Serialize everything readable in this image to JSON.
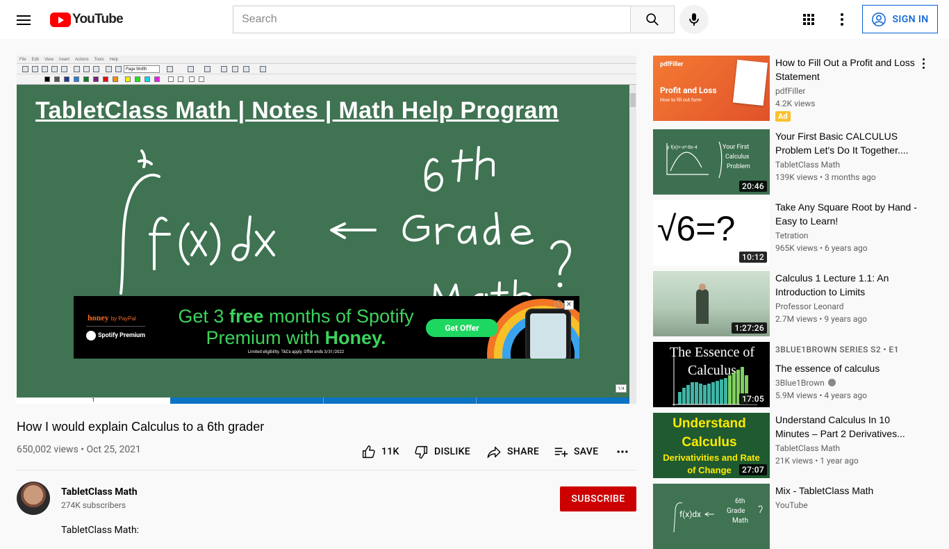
{
  "header": {
    "logo_text": "YouTube",
    "search_placeholder": "Search",
    "signin_label": "SIGN IN"
  },
  "player": {
    "board_title": "TabletClass Math | Notes  | Math Help Program",
    "app_menu": [
      "File",
      "Edit",
      "View",
      "Insert",
      "Actions",
      "Tools",
      "Help"
    ],
    "zoom_select": "Page Width",
    "page_tab": "1",
    "page_indicator": "1/4",
    "ad": {
      "brand": "honey",
      "brand_sub": "by PayPal",
      "partner": "Spotify Premium",
      "headline_1a": "Get 3 ",
      "headline_1b": "free",
      "headline_1c": " months of Spotify",
      "headline_2a": "Premium with ",
      "headline_2b": "Honey.",
      "fine_print": "Limited eligibility. T&Cs apply. Offer ends 3/31/2022",
      "cta": "Get Offer",
      "info": "i",
      "close": "✕"
    }
  },
  "video": {
    "title": "How I would explain Calculus to a 6th grader",
    "views": "650,002 views",
    "date": "Oct 25, 2021",
    "likes": "11K",
    "dislike_label": "DISLIKE",
    "share_label": "SHARE",
    "save_label": "SAVE"
  },
  "channel": {
    "name": "TabletClass Math",
    "subscribers": "274K subscribers",
    "subscribe_label": "SUBSCRIBE",
    "description_start": "TabletClass Math:"
  },
  "recommendations": [
    {
      "title": "How to Fill Out a Profit and Loss Statement",
      "channel": "pdfFiller",
      "views": "4.2K views",
      "badge": "Ad",
      "thumb_title": "Profit and Loss",
      "thumb_sub": "How to fill out form",
      "thumb_brand": "pdfFiller"
    },
    {
      "title": "Your First Basic CALCULUS Problem Let's Do It Together....",
      "channel": "TabletClass Math",
      "views": "139K views • 3 months ago",
      "duration": "20:46"
    },
    {
      "title": "Take Any Square Root by Hand - Easy to Learn!",
      "channel": "Tetration",
      "views": "965K views • 6 years ago",
      "duration": "10:12",
      "thumb_text": "√6=?"
    },
    {
      "title": "Calculus 1 Lecture 1.1: An Introduction to Limits",
      "channel": "Professor Leonard",
      "views": "2.7M views • 9 years ago",
      "duration": "1:27:26"
    },
    {
      "title": "The essence of calculus",
      "series": "3BLUE1BROWN SERIES   S2 • E1",
      "channel": "3Blue1Brown",
      "views": "5.9M views • 4 years ago",
      "duration": "17:05",
      "thumb_text": "The Essence of Calculus"
    },
    {
      "title": "Understand Calculus In 10 Minutes – Part 2 Derivatives...",
      "channel": "TabletClass Math",
      "views": "21K views • 1 year ago",
      "duration": "27:07",
      "thumb_line1": "Understand",
      "thumb_line2": "Calculus",
      "thumb_line3": "Derivativities and Rate",
      "thumb_line4": "of Change"
    },
    {
      "title": "Mix - TabletClass Math",
      "channel": "YouTube"
    }
  ]
}
